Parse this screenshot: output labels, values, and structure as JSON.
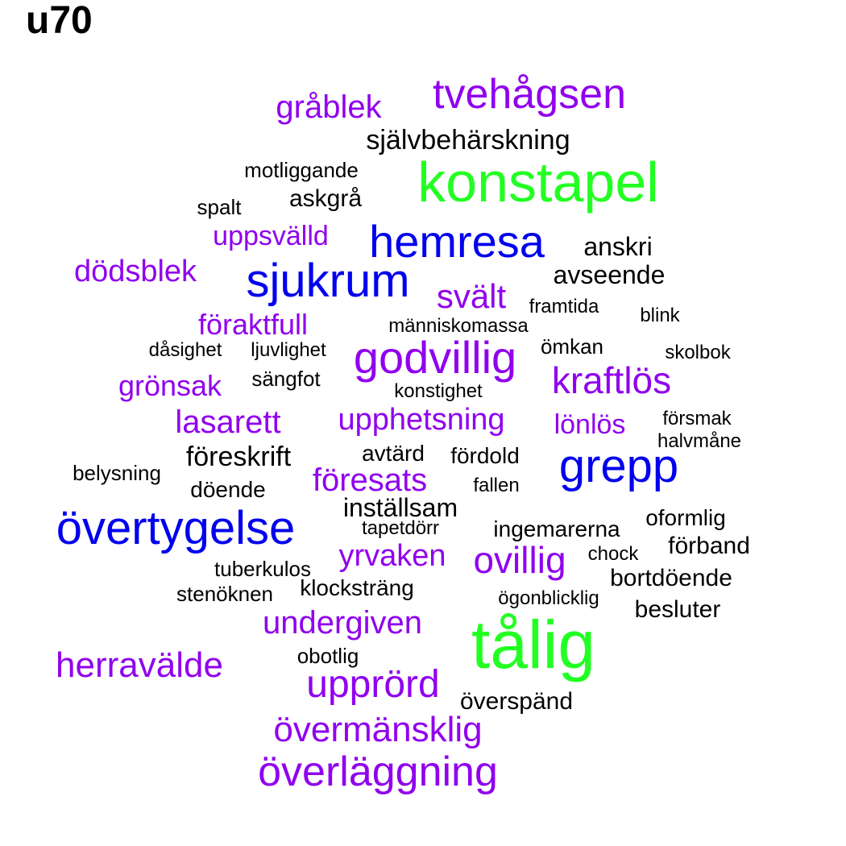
{
  "title": "u70",
  "colors": {
    "green": "#22ff22",
    "blue": "#0000ee",
    "purple": "#9000ee",
    "black": "#000000"
  },
  "words": [
    {
      "text": "tvehågsen",
      "color": "purple"
    },
    {
      "text": "gråblek",
      "color": "purple"
    },
    {
      "text": "självbehärskning",
      "color": "black"
    },
    {
      "text": "konstapel",
      "color": "green"
    },
    {
      "text": "motliggande",
      "color": "black"
    },
    {
      "text": "askgrå",
      "color": "black"
    },
    {
      "text": "spalt",
      "color": "black"
    },
    {
      "text": "uppsvälld",
      "color": "purple"
    },
    {
      "text": "hemresa",
      "color": "blue"
    },
    {
      "text": "anskri",
      "color": "black"
    },
    {
      "text": "dödsblek",
      "color": "purple"
    },
    {
      "text": "sjukrum",
      "color": "blue"
    },
    {
      "text": "svält",
      "color": "purple"
    },
    {
      "text": "avseende",
      "color": "black"
    },
    {
      "text": "framtida",
      "color": "black"
    },
    {
      "text": "blink",
      "color": "black"
    },
    {
      "text": "föraktfull",
      "color": "purple"
    },
    {
      "text": "människomassa",
      "color": "black"
    },
    {
      "text": "dåsighet",
      "color": "black"
    },
    {
      "text": "ljuvlighet",
      "color": "black"
    },
    {
      "text": "godvillig",
      "color": "purple"
    },
    {
      "text": "ömkan",
      "color": "black"
    },
    {
      "text": "skolbok",
      "color": "black"
    },
    {
      "text": "grönsak",
      "color": "purple"
    },
    {
      "text": "sängfot",
      "color": "black"
    },
    {
      "text": "kraftlös",
      "color": "purple"
    },
    {
      "text": "konstighet",
      "color": "black"
    },
    {
      "text": "lasarett",
      "color": "purple"
    },
    {
      "text": "upphetsning",
      "color": "purple"
    },
    {
      "text": "lönlös",
      "color": "purple"
    },
    {
      "text": "försmak",
      "color": "black"
    },
    {
      "text": "halvmåne",
      "color": "black"
    },
    {
      "text": "föreskrift",
      "color": "black"
    },
    {
      "text": "avtärd",
      "color": "black"
    },
    {
      "text": "fördold",
      "color": "black"
    },
    {
      "text": "grepp",
      "color": "blue"
    },
    {
      "text": "belysning",
      "color": "black"
    },
    {
      "text": "föresats",
      "color": "purple"
    },
    {
      "text": "döende",
      "color": "black"
    },
    {
      "text": "fallen",
      "color": "black"
    },
    {
      "text": "inställsam",
      "color": "black"
    },
    {
      "text": "övertygelse",
      "color": "blue"
    },
    {
      "text": "tapetdörr",
      "color": "black"
    },
    {
      "text": "ingemarerna",
      "color": "black"
    },
    {
      "text": "oformlig",
      "color": "black"
    },
    {
      "text": "förband",
      "color": "black"
    },
    {
      "text": "yrvaken",
      "color": "purple"
    },
    {
      "text": "ovillig",
      "color": "purple"
    },
    {
      "text": "chock",
      "color": "black"
    },
    {
      "text": "tuberkulos",
      "color": "black"
    },
    {
      "text": "bortdöende",
      "color": "black"
    },
    {
      "text": "klocksträng",
      "color": "black"
    },
    {
      "text": "stenöknen",
      "color": "black"
    },
    {
      "text": "ögonblicklig",
      "color": "black"
    },
    {
      "text": "besluter",
      "color": "black"
    },
    {
      "text": "undergiven",
      "color": "purple"
    },
    {
      "text": "tålig",
      "color": "green"
    },
    {
      "text": "herravälde",
      "color": "purple"
    },
    {
      "text": "obotlig",
      "color": "black"
    },
    {
      "text": "upprörd",
      "color": "purple"
    },
    {
      "text": "överspänd",
      "color": "black"
    },
    {
      "text": "övermänsklig",
      "color": "purple"
    },
    {
      "text": "överläggning",
      "color": "purple"
    }
  ]
}
